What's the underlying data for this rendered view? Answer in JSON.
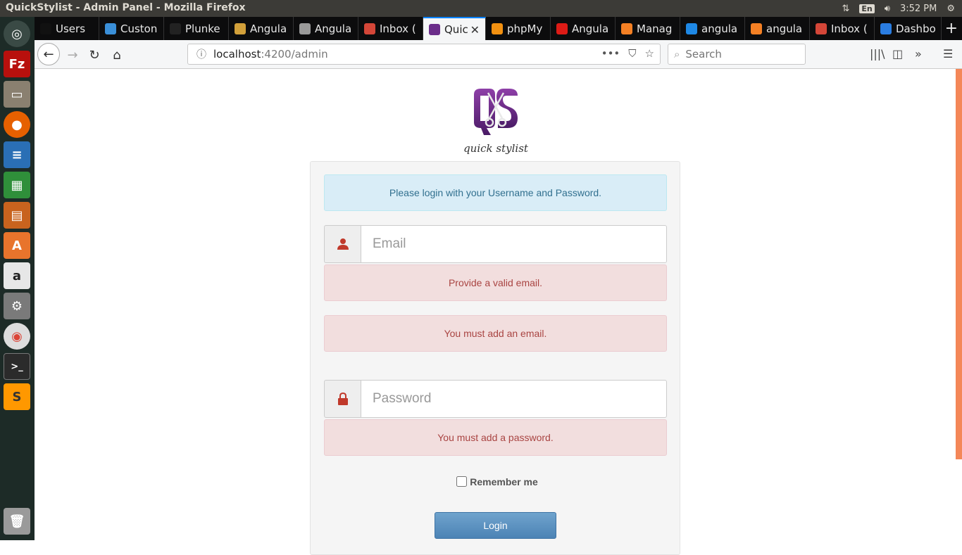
{
  "system": {
    "window_title": "QuickStylist - Admin Panel - Mozilla Firefox",
    "language": "En",
    "time": "3:52 PM"
  },
  "tabs": [
    {
      "label": "Users",
      "icon": "users-favicon",
      "color": "#111111"
    },
    {
      "label": "Custon",
      "icon": "custom-favicon",
      "color": "#3a8fd8"
    },
    {
      "label": "Plunke",
      "icon": "plunker-favicon",
      "color": "#222222"
    },
    {
      "label": "Angula",
      "icon": "angular-trophy-favicon",
      "color": "#d2a03a"
    },
    {
      "label": "Angula",
      "icon": "angular-favicon",
      "color": "#9a9a9a"
    },
    {
      "label": "Inbox (",
      "icon": "gmail-favicon",
      "color": "#d44638"
    },
    {
      "label": "Quic",
      "icon": "quickstylist-favicon",
      "color": "#6b2d8a",
      "active": true
    },
    {
      "label": "phpMy",
      "icon": "phpmyadmin-favicon",
      "color": "#f29111"
    },
    {
      "label": "Angula",
      "icon": "angular-red-favicon",
      "color": "#dd1b16"
    },
    {
      "label": "Manag",
      "icon": "stackoverflow-favicon",
      "color": "#f48024"
    },
    {
      "label": "angula",
      "icon": "bolt-favicon",
      "color": "#1e88e5"
    },
    {
      "label": "angula",
      "icon": "stackoverflow2-favicon",
      "color": "#f48024"
    },
    {
      "label": "Inbox (",
      "icon": "gmail2-favicon",
      "color": "#d44638"
    },
    {
      "label": "Dashbo",
      "icon": "dashboard-favicon",
      "color": "#2a7de1"
    }
  ],
  "nav": {
    "url_host": "localhost",
    "url_path": ":4200/admin",
    "search_placeholder": "Search"
  },
  "page": {
    "tagline": "quick stylist",
    "info_message": "Please login with your Username and Password.",
    "email_placeholder": "Email",
    "email_error_valid": "Provide a valid email.",
    "email_error_required": "You must add an email.",
    "password_placeholder": "Password",
    "password_error_required": "You must add a password.",
    "remember_label": "Remember me",
    "login_label": "Login"
  },
  "colors": {
    "accent": "#0a84ff",
    "scrollbar": "#f48758",
    "error_text": "#a94442",
    "info_text": "#31708f"
  }
}
